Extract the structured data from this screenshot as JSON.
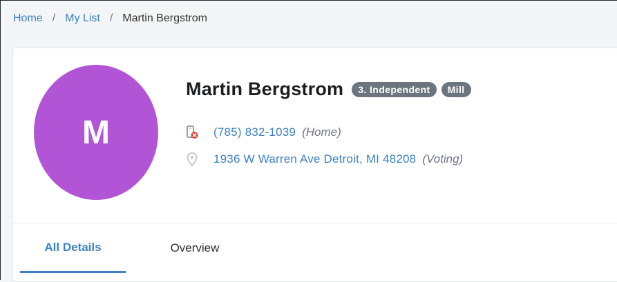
{
  "breadcrumb": {
    "home": "Home",
    "separator": "/",
    "list": "My List",
    "current": "Martin Bergstrom"
  },
  "contact": {
    "initial": "M",
    "avatar_color": "#b155d6",
    "name": "Martin Bergstrom",
    "badges": [
      "3. Independent",
      "Mill"
    ],
    "phone": {
      "number": "(785) 832-1039",
      "type": "(Home)",
      "icon": "mobile-phone-blocked-icon"
    },
    "address": {
      "text": "1936 W Warren Ave Detroit, MI 48208",
      "type": "(Voting)",
      "icon": "map-pin-icon"
    }
  },
  "tabs": [
    {
      "label": "All Details",
      "active": true
    },
    {
      "label": "Overview",
      "active": false
    }
  ],
  "colors": {
    "link": "#3b82c4",
    "badge": "#6c757d",
    "page_background": "#f4f5f7"
  }
}
